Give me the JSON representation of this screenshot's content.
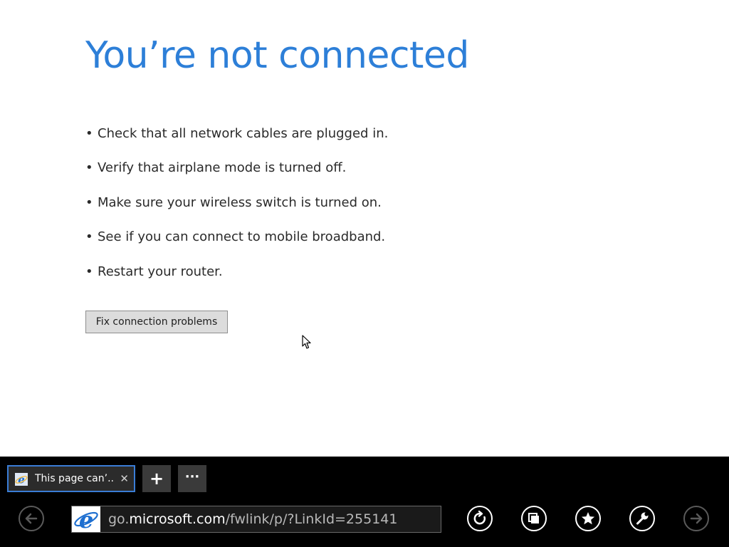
{
  "error_page": {
    "title": "You’re not connected",
    "tips": [
      "Check that all network cables are plugged in.",
      "Verify that airplane mode is turned off.",
      "Make sure your wireless switch is turned on.",
      "See if you can connect to mobile broadband.",
      "Restart your router."
    ],
    "bullet": "•",
    "fix_button_label": "Fix connection problems"
  },
  "app_bar": {
    "tab": {
      "title": "This page can’...",
      "close_glyph": "✕",
      "icon": "ie-favicon-icon"
    },
    "new_tab_glyph": "+",
    "more_glyph": "···",
    "address": {
      "prefix": "go.",
      "domain": "microsoft.com",
      "path": "/fwlink/p/?LinkId=255141",
      "site_icon": "ie-logo-icon"
    },
    "buttons": {
      "back": "back-arrow-icon",
      "refresh": "refresh-icon",
      "pin": "pin-to-start-icon",
      "favorites": "star-icon",
      "tools": "wrench-icon",
      "forward": "forward-arrow-icon"
    }
  },
  "colors": {
    "title_blue": "#2d7fd8",
    "tab_border": "#3a7dd6",
    "ie_blue": "#1e6fd0",
    "app_bar_bg": "#000000"
  }
}
